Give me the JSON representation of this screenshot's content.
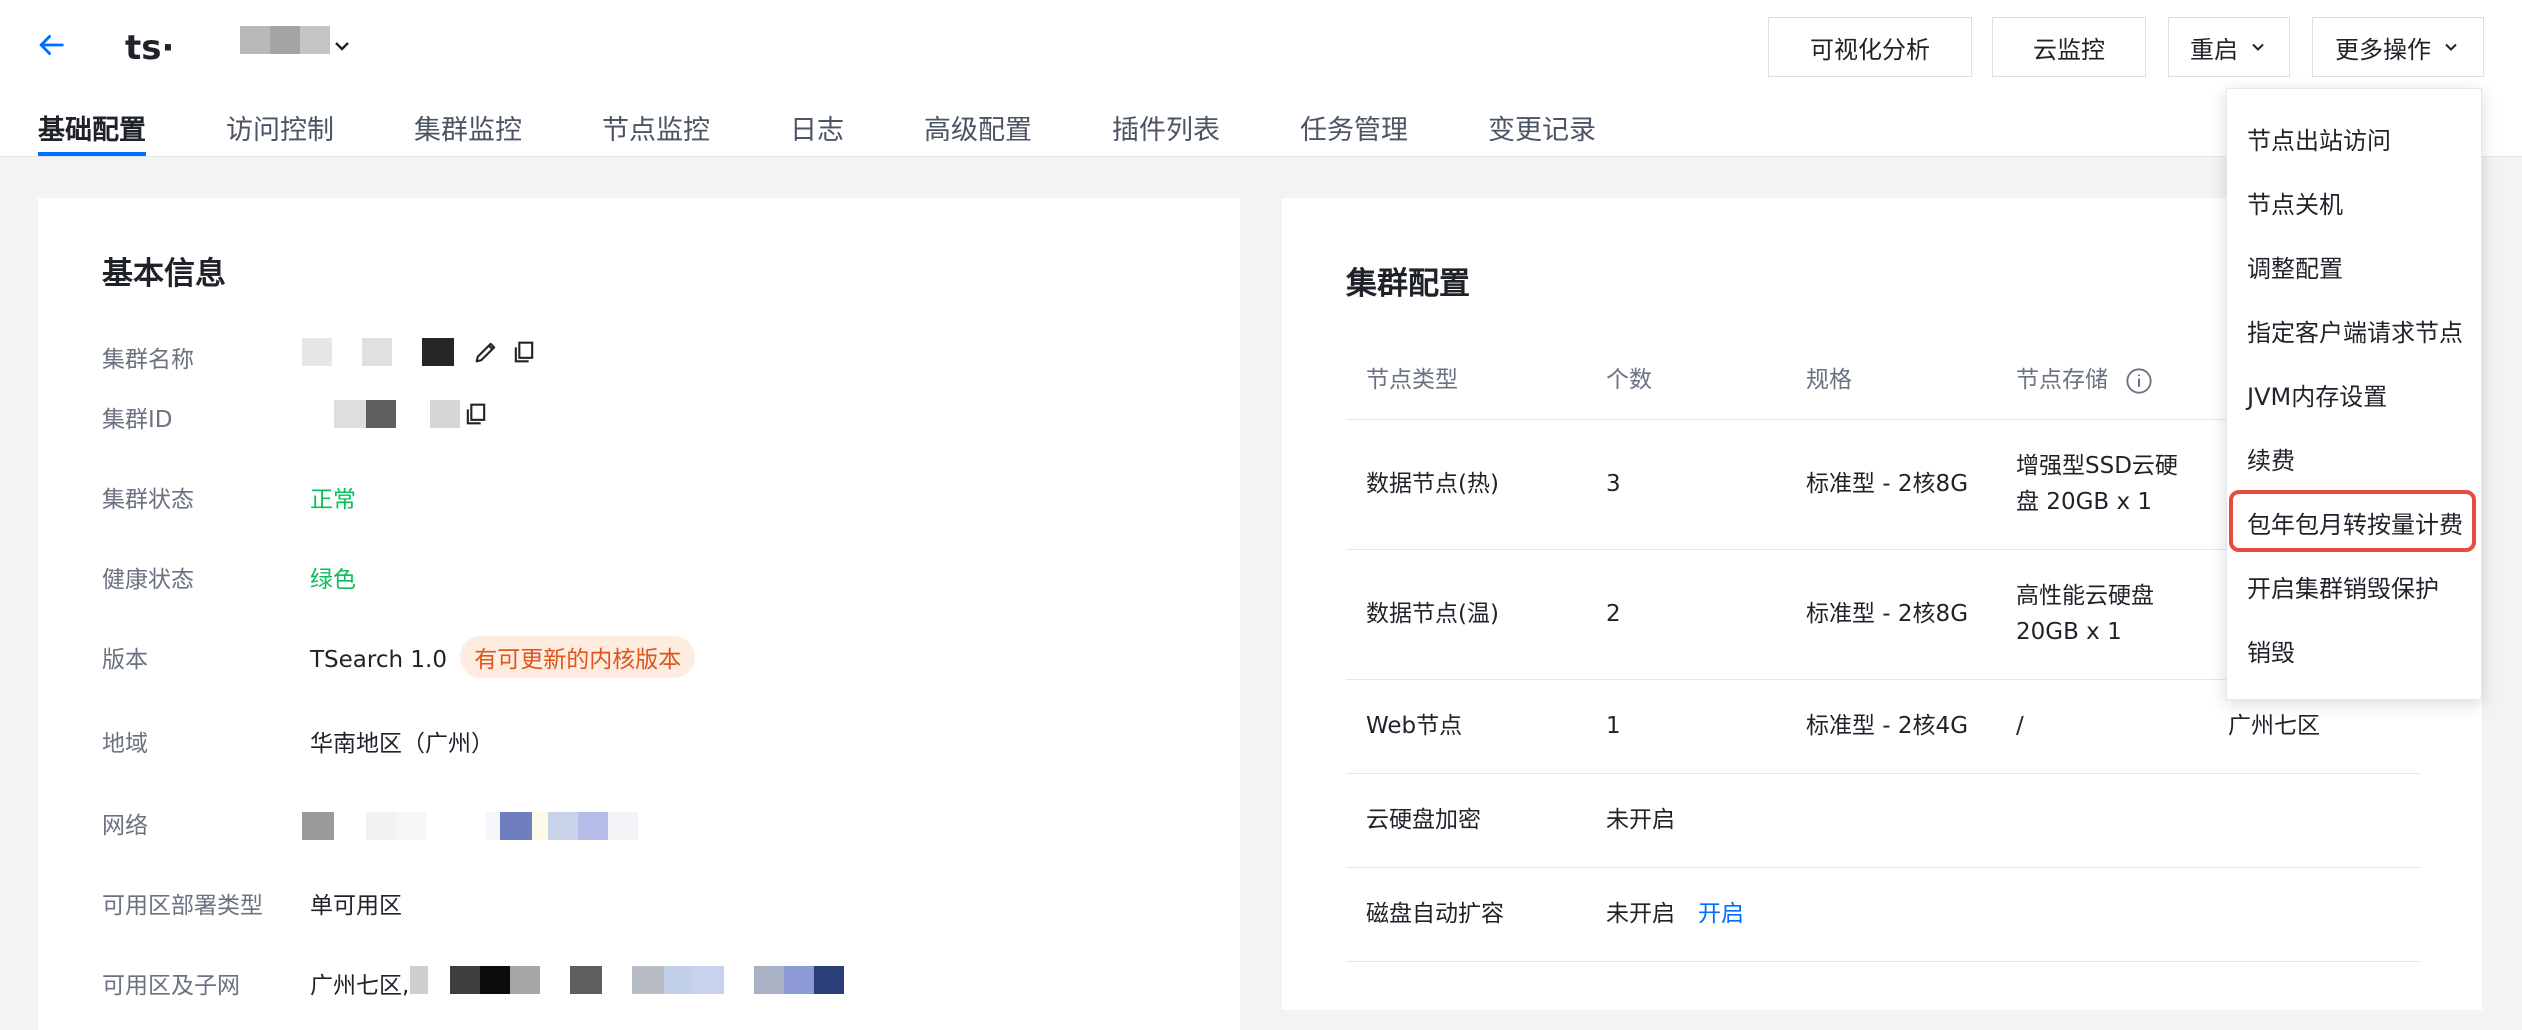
{
  "header": {
    "cluster_name": "ts·",
    "buttons": {
      "visual_analysis": "可视化分析",
      "cloud_monitor": "云监控",
      "restart": "重启",
      "more_actions": "更多操作"
    }
  },
  "tabs": [
    {
      "label": "基础配置"
    },
    {
      "label": "访问控制"
    },
    {
      "label": "集群监控"
    },
    {
      "label": "节点监控"
    },
    {
      "label": "日志"
    },
    {
      "label": "高级配置"
    },
    {
      "label": "插件列表"
    },
    {
      "label": "任务管理"
    },
    {
      "label": "变更记录"
    }
  ],
  "basic_info": {
    "title": "基本信息",
    "labels": {
      "cluster_name": "集群名称",
      "cluster_id": "集群ID",
      "cluster_status": "集群状态",
      "health_status": "健康状态",
      "version": "版本",
      "region": "地域",
      "network": "网络",
      "az_deploy_type": "可用区部署类型",
      "az_subnet": "可用区及子网"
    },
    "values": {
      "cluster_status": "正常",
      "health_status": "绿色",
      "version": "TSearch 1.0",
      "version_badge": "有可更新的内核版本",
      "region": "华南地区（广州）",
      "az_deploy_type": "单可用区",
      "az_subnet_prefix": "广州七区,"
    }
  },
  "cluster_config": {
    "title": "集群配置",
    "columns": [
      "节点类型",
      "个数",
      "规格",
      "节点存储"
    ],
    "rows": [
      {
        "type": "数据节点(热)",
        "count": "3",
        "spec": "标准型 - 2核8G",
        "storage_1": "增强型SSD云硬",
        "storage_2": "盘 20GB x 1",
        "zone": ""
      },
      {
        "type": "数据节点(温)",
        "count": "2",
        "spec": "标准型 - 2核8G",
        "storage_1": "高性能云硬盘",
        "storage_2": "20GB x 1",
        "zone": ""
      },
      {
        "type": "Web节点",
        "count": "1",
        "spec": "标准型 - 2核4G",
        "storage_1": "/",
        "storage_2": "",
        "zone": "广州七区"
      }
    ],
    "disk_encryption": {
      "label": "云硬盘加密",
      "value": "未开启"
    },
    "disk_autoscale": {
      "label": "磁盘自动扩容",
      "value": "未开启",
      "action": "开启"
    }
  },
  "more_menu": {
    "items": [
      "节点出站访问",
      "节点关机",
      "调整配置",
      "指定客户端请求节点",
      "JVM内存设置",
      "续费",
      "包年包月转按量计费",
      "开启集群销毁保护",
      "销毁"
    ]
  },
  "colors": {
    "accent": "#006eff",
    "success": "#0abf5b",
    "badge_text": "#e0551b",
    "badge_bg": "#fdecdf",
    "highlight": "#e74c3c"
  }
}
